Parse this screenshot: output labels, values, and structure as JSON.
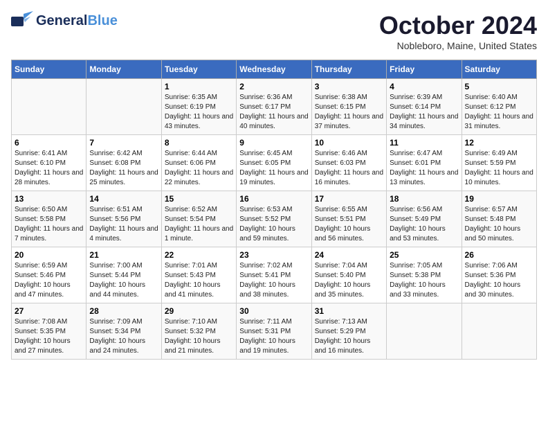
{
  "logo": {
    "name_part1": "General",
    "name_part2": "Blue",
    "tagline": ""
  },
  "header": {
    "month": "October 2024",
    "location": "Nobleboro, Maine, United States"
  },
  "weekdays": [
    "Sunday",
    "Monday",
    "Tuesday",
    "Wednesday",
    "Thursday",
    "Friday",
    "Saturday"
  ],
  "weeks": [
    [
      {
        "day": "",
        "info": ""
      },
      {
        "day": "",
        "info": ""
      },
      {
        "day": "1",
        "info": "Sunrise: 6:35 AM\nSunset: 6:19 PM\nDaylight: 11 hours and 43 minutes."
      },
      {
        "day": "2",
        "info": "Sunrise: 6:36 AM\nSunset: 6:17 PM\nDaylight: 11 hours and 40 minutes."
      },
      {
        "day": "3",
        "info": "Sunrise: 6:38 AM\nSunset: 6:15 PM\nDaylight: 11 hours and 37 minutes."
      },
      {
        "day": "4",
        "info": "Sunrise: 6:39 AM\nSunset: 6:14 PM\nDaylight: 11 hours and 34 minutes."
      },
      {
        "day": "5",
        "info": "Sunrise: 6:40 AM\nSunset: 6:12 PM\nDaylight: 11 hours and 31 minutes."
      }
    ],
    [
      {
        "day": "6",
        "info": "Sunrise: 6:41 AM\nSunset: 6:10 PM\nDaylight: 11 hours and 28 minutes."
      },
      {
        "day": "7",
        "info": "Sunrise: 6:42 AM\nSunset: 6:08 PM\nDaylight: 11 hours and 25 minutes."
      },
      {
        "day": "8",
        "info": "Sunrise: 6:44 AM\nSunset: 6:06 PM\nDaylight: 11 hours and 22 minutes."
      },
      {
        "day": "9",
        "info": "Sunrise: 6:45 AM\nSunset: 6:05 PM\nDaylight: 11 hours and 19 minutes."
      },
      {
        "day": "10",
        "info": "Sunrise: 6:46 AM\nSunset: 6:03 PM\nDaylight: 11 hours and 16 minutes."
      },
      {
        "day": "11",
        "info": "Sunrise: 6:47 AM\nSunset: 6:01 PM\nDaylight: 11 hours and 13 minutes."
      },
      {
        "day": "12",
        "info": "Sunrise: 6:49 AM\nSunset: 5:59 PM\nDaylight: 11 hours and 10 minutes."
      }
    ],
    [
      {
        "day": "13",
        "info": "Sunrise: 6:50 AM\nSunset: 5:58 PM\nDaylight: 11 hours and 7 minutes."
      },
      {
        "day": "14",
        "info": "Sunrise: 6:51 AM\nSunset: 5:56 PM\nDaylight: 11 hours and 4 minutes."
      },
      {
        "day": "15",
        "info": "Sunrise: 6:52 AM\nSunset: 5:54 PM\nDaylight: 11 hours and 1 minute."
      },
      {
        "day": "16",
        "info": "Sunrise: 6:53 AM\nSunset: 5:52 PM\nDaylight: 10 hours and 59 minutes."
      },
      {
        "day": "17",
        "info": "Sunrise: 6:55 AM\nSunset: 5:51 PM\nDaylight: 10 hours and 56 minutes."
      },
      {
        "day": "18",
        "info": "Sunrise: 6:56 AM\nSunset: 5:49 PM\nDaylight: 10 hours and 53 minutes."
      },
      {
        "day": "19",
        "info": "Sunrise: 6:57 AM\nSunset: 5:48 PM\nDaylight: 10 hours and 50 minutes."
      }
    ],
    [
      {
        "day": "20",
        "info": "Sunrise: 6:59 AM\nSunset: 5:46 PM\nDaylight: 10 hours and 47 minutes."
      },
      {
        "day": "21",
        "info": "Sunrise: 7:00 AM\nSunset: 5:44 PM\nDaylight: 10 hours and 44 minutes."
      },
      {
        "day": "22",
        "info": "Sunrise: 7:01 AM\nSunset: 5:43 PM\nDaylight: 10 hours and 41 minutes."
      },
      {
        "day": "23",
        "info": "Sunrise: 7:02 AM\nSunset: 5:41 PM\nDaylight: 10 hours and 38 minutes."
      },
      {
        "day": "24",
        "info": "Sunrise: 7:04 AM\nSunset: 5:40 PM\nDaylight: 10 hours and 35 minutes."
      },
      {
        "day": "25",
        "info": "Sunrise: 7:05 AM\nSunset: 5:38 PM\nDaylight: 10 hours and 33 minutes."
      },
      {
        "day": "26",
        "info": "Sunrise: 7:06 AM\nSunset: 5:36 PM\nDaylight: 10 hours and 30 minutes."
      }
    ],
    [
      {
        "day": "27",
        "info": "Sunrise: 7:08 AM\nSunset: 5:35 PM\nDaylight: 10 hours and 27 minutes."
      },
      {
        "day": "28",
        "info": "Sunrise: 7:09 AM\nSunset: 5:34 PM\nDaylight: 10 hours and 24 minutes."
      },
      {
        "day": "29",
        "info": "Sunrise: 7:10 AM\nSunset: 5:32 PM\nDaylight: 10 hours and 21 minutes."
      },
      {
        "day": "30",
        "info": "Sunrise: 7:11 AM\nSunset: 5:31 PM\nDaylight: 10 hours and 19 minutes."
      },
      {
        "day": "31",
        "info": "Sunrise: 7:13 AM\nSunset: 5:29 PM\nDaylight: 10 hours and 16 minutes."
      },
      {
        "day": "",
        "info": ""
      },
      {
        "day": "",
        "info": ""
      }
    ]
  ]
}
